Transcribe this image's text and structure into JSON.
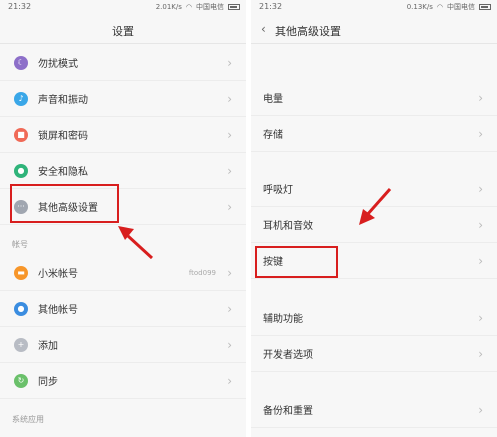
{
  "left": {
    "status": {
      "time": "21:32",
      "speed": "2.01K/s",
      "carrier": "中国电信"
    },
    "title": "设置",
    "rows": [
      {
        "label": "勿扰模式",
        "icon": "moon-icon",
        "color": "#8d6fc9",
        "glyph": "☾"
      },
      {
        "label": "声音和振动",
        "icon": "speaker-icon",
        "color": "#3aa7e8",
        "glyph": "♪"
      },
      {
        "label": "锁屏和密码",
        "icon": "lock-icon",
        "color": "#f06a57",
        "glyph": "■"
      },
      {
        "label": "安全和隐私",
        "icon": "shield-icon",
        "color": "#2fb47a",
        "glyph": "●"
      },
      {
        "label": "其他高级设置",
        "icon": "more-dots-icon",
        "color": "#a0a6b0",
        "glyph": "···"
      }
    ],
    "section_account": "帐号",
    "account_rows": [
      {
        "label": "小米帐号",
        "icon": "mi-account-icon",
        "color": "#f7962a",
        "glyph": "▬",
        "value": "ftod099"
      },
      {
        "label": "其他帐号",
        "icon": "user-icon",
        "color": "#3b8de0",
        "glyph": "●"
      },
      {
        "label": "添加",
        "icon": "plus-icon",
        "color": "#b8bcc4",
        "glyph": "+"
      },
      {
        "label": "同步",
        "icon": "sync-icon",
        "color": "#6ac06a",
        "glyph": "↻"
      }
    ],
    "section_system": "系统应用"
  },
  "right": {
    "status": {
      "time": "21:32",
      "speed": "0.13K/s",
      "carrier": "中国电信"
    },
    "title": "其他高级设置",
    "rows": [
      {
        "label": "电量"
      },
      {
        "label": "存储"
      },
      {
        "label": "呼吸灯"
      },
      {
        "label": "耳机和音效"
      },
      {
        "label": "按键"
      },
      {
        "label": "辅助功能"
      },
      {
        "label": "开发者选项"
      },
      {
        "label": "备份和重置"
      }
    ]
  },
  "colors": {
    "highlight": "#d81e1e"
  }
}
